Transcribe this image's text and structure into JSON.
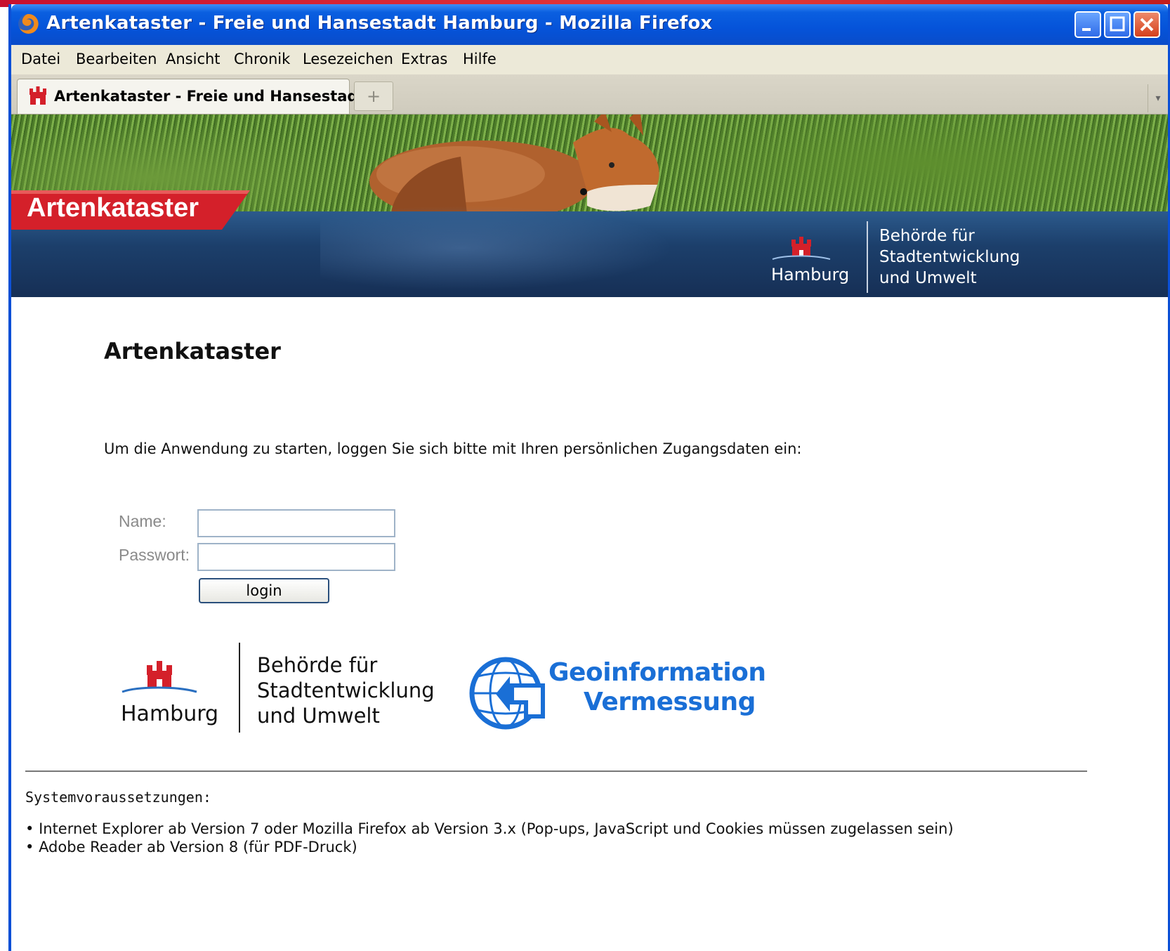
{
  "window": {
    "title": "Artenkataster - Freie und Hansestadt Hamburg - Mozilla Firefox",
    "controls": [
      "minimize",
      "maximize",
      "close"
    ]
  },
  "menubar": {
    "items": [
      {
        "label": "Datei"
      },
      {
        "label": "Bearbeiten"
      },
      {
        "label": "Ansicht"
      },
      {
        "label": "Chronik"
      },
      {
        "label": "Lesezeichen"
      },
      {
        "label": "Extras"
      },
      {
        "label": "Hilfe"
      }
    ]
  },
  "tabs": {
    "active": {
      "label": "Artenkataster - Freie und Hansestad..."
    },
    "new_tab_icon": "plus-icon"
  },
  "banner": {
    "title": "Artenkataster",
    "city": "Hamburg",
    "authority_lines": [
      "Behörde für",
      "Stadtentwicklung",
      "und Umwelt"
    ]
  },
  "main": {
    "heading": "Artenkataster",
    "intro": "Um die Anwendung zu starten, loggen Sie sich bitte mit Ihren persönlichen Zugangsdaten ein:",
    "form": {
      "name_label": "Name:",
      "name_value": "",
      "password_label": "Passwort:",
      "password_value": "",
      "login_label": "login"
    },
    "logos": {
      "city": "Hamburg",
      "authority_lines": [
        "Behörde für",
        "Stadtentwicklung",
        "und Umwelt"
      ],
      "geo_line1": "Geoinformation",
      "geo_line2": "Vermessung"
    }
  },
  "requirements": {
    "heading": "Systemvoraussetzungen:",
    "items": [
      "Internet Explorer ab Version 7 oder Mozilla Firefox ab Version 3.x (Pop-ups, JavaScript und Cookies müssen zugelassen sein)",
      "Adobe Reader ab Version 8 (für PDF-Druck)"
    ]
  },
  "colors": {
    "titlebar": "#0553d9",
    "banner_red": "#d4202a",
    "banner_blue": "#1c3f6b",
    "geo_blue": "#1a6fd6"
  }
}
